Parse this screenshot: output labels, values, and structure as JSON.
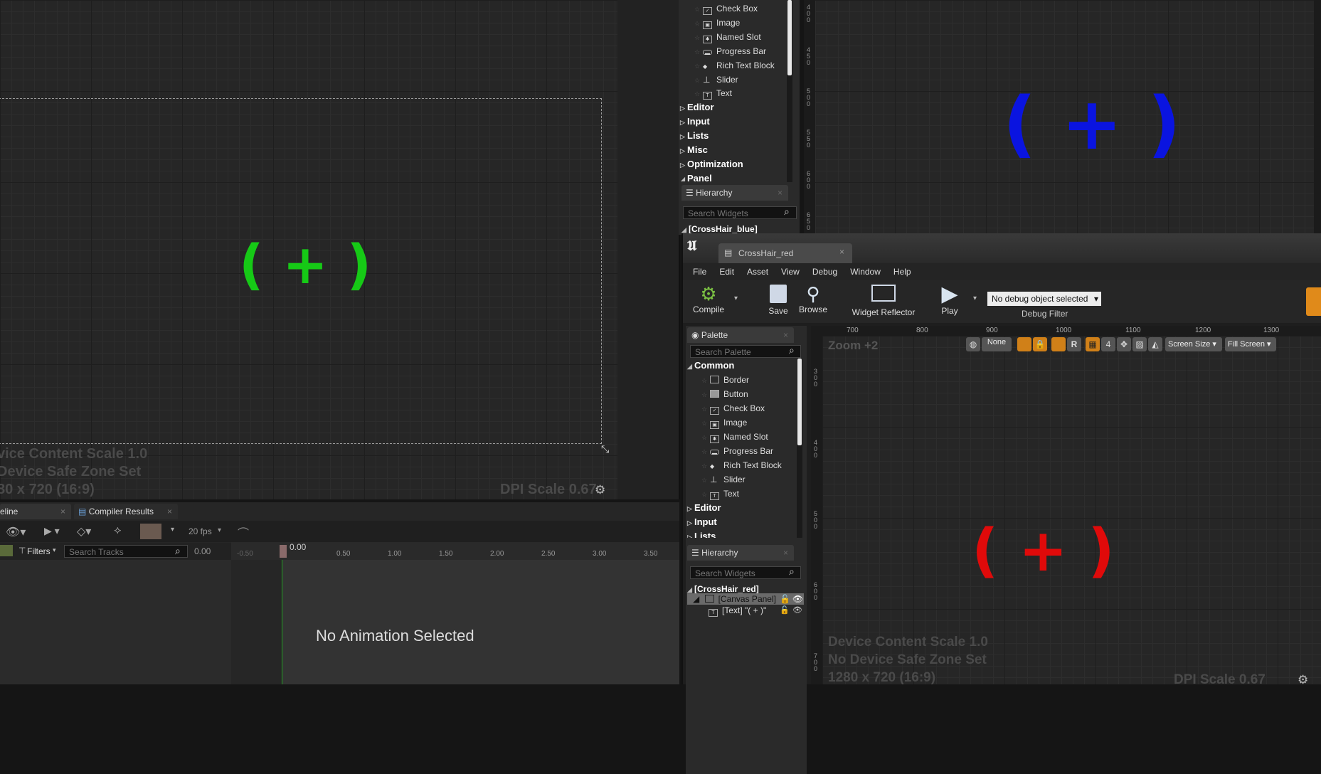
{
  "left_viewport": {
    "crosshair_text": "( + )",
    "crosshair_color": "#16c916",
    "info_line1": "vice Content Scale 1.0",
    "info_line2": "Device Safe Zone Set",
    "info_line3": "80 x 720 (16:9)",
    "dpi": "DPI Scale 0.67"
  },
  "bottom_left": {
    "tabs": [
      {
        "label": "eline"
      },
      {
        "label": "Compiler Results"
      }
    ],
    "fps": "20 fps",
    "filters_label": "Filters",
    "search_placeholder": "Search Tracks",
    "time_value": "0.00",
    "playhead_label": "0.00",
    "ruler_ticks": [
      "-0.50",
      "0.50",
      "1.00",
      "1.50",
      "2.00",
      "2.50",
      "3.00",
      "3.50"
    ],
    "empty_message": "No Animation Selected"
  },
  "top_palette": {
    "items": [
      "Check Box",
      "Image",
      "Named Slot",
      "Progress Bar",
      "Rich Text Block",
      "Slider",
      "Text"
    ],
    "categories": [
      "Editor",
      "Input",
      "Lists",
      "Misc",
      "Optimization",
      "Panel"
    ]
  },
  "top_hierarchy": {
    "tab_label": "Hierarchy",
    "search_placeholder": "Search Widgets",
    "root": "[CrossHair_blue]"
  },
  "top_right_viewport": {
    "crosshair_text": "( + )",
    "crosshair_color": "#0a14e0",
    "ruler_labels": [
      "4\n0\n0",
      "4\n5\n0",
      "5\n0\n0",
      "5\n5\n0",
      "6\n0\n0",
      "6\n5\n0"
    ]
  },
  "red_editor": {
    "tab_title": "CrossHair_red",
    "menu": [
      "File",
      "Edit",
      "Asset",
      "View",
      "Debug",
      "Window",
      "Help"
    ],
    "toolbar": {
      "compile": "Compile",
      "save": "Save",
      "browse": "Browse",
      "widget_reflector": "Widget Reflector",
      "play": "Play",
      "debug_dropdown": "No debug object selected",
      "debug_filter": "Debug Filter"
    },
    "palette": {
      "tab_label": "Palette",
      "search_placeholder": "Search Palette",
      "common_label": "Common",
      "items": [
        "Border",
        "Button",
        "Check Box",
        "Image",
        "Named Slot",
        "Progress Bar",
        "Rich Text Block",
        "Slider",
        "Text"
      ],
      "categories": [
        "Editor",
        "Input",
        "Lists"
      ]
    },
    "hierarchy": {
      "tab_label": "Hierarchy",
      "search_placeholder": "Search Widgets",
      "root": "[CrossHair_red]",
      "canvas": "[Canvas Panel]",
      "text_node": "[Text] \"( + )\""
    },
    "viewport": {
      "zoom": "Zoom +2",
      "ruler_ticks": [
        "700",
        "800",
        "900",
        "1000",
        "1100",
        "1200",
        "1300"
      ],
      "none_label": "None",
      "r_label": "R",
      "grid_value": "4",
      "screen_size": "Screen Size",
      "fill_screen": "Fill Screen",
      "crosshair_text": "( + )",
      "crosshair_color": "#e00a0a",
      "info_line1": "Device Content Scale 1.0",
      "info_line2": "No Device Safe Zone Set",
      "info_line3": "1280 x 720 (16:9)",
      "dpi": "DPI Scale 0.67",
      "left_ruler": [
        "3\n0\n0",
        "4\n0\n0",
        "5\n0\n0",
        "6\n0\n0",
        "7\n0\n0"
      ]
    }
  }
}
